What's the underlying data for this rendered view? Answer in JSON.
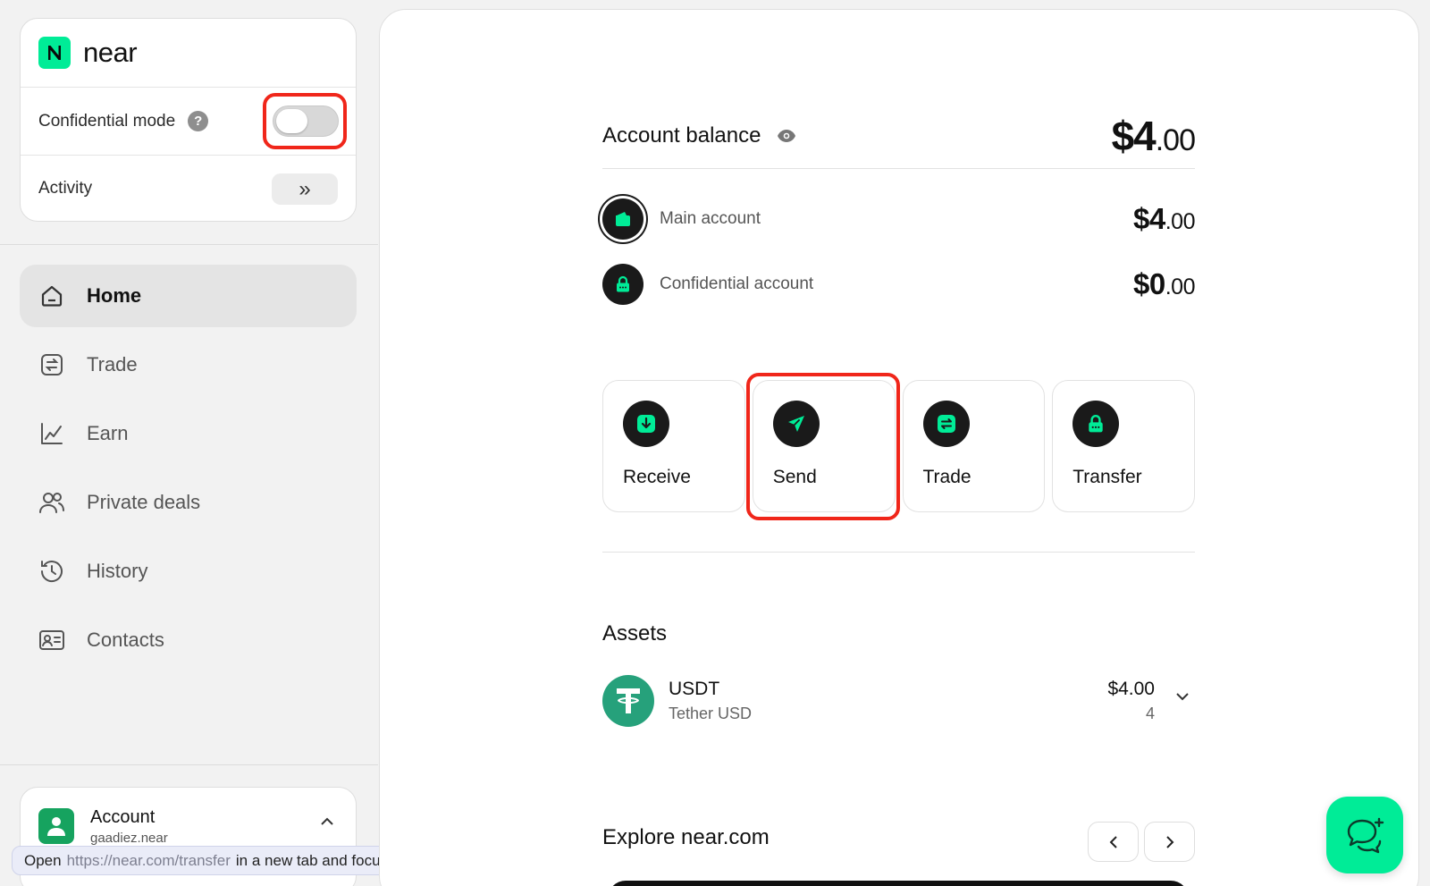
{
  "brand": {
    "name": "near"
  },
  "top_card": {
    "confidential_label": "Confidential mode",
    "help_icon": "?",
    "confidential_enabled": false,
    "activity_label": "Activity",
    "activity_icon": "»"
  },
  "nav": {
    "items": [
      {
        "label": "Home",
        "icon": "home-icon",
        "active": true
      },
      {
        "label": "Trade",
        "icon": "trade-icon",
        "active": false
      },
      {
        "label": "Earn",
        "icon": "chart-icon",
        "active": false
      },
      {
        "label": "Private deals",
        "icon": "users-icon",
        "active": false
      },
      {
        "label": "History",
        "icon": "history-icon",
        "active": false
      },
      {
        "label": "Contacts",
        "icon": "contact-card-icon",
        "active": false
      }
    ]
  },
  "account": {
    "title": "Account",
    "subtitle": "gaadiez.near"
  },
  "tooltip": {
    "prefix": "Open",
    "url": "https://near.com/transfer",
    "suffix": "in a new tab and focus it"
  },
  "balance": {
    "label": "Account balance",
    "whole": "$4",
    "cents": ".00"
  },
  "accounts": [
    {
      "label": "Main account",
      "whole": "$4",
      "cents": ".00",
      "icon": "wallet-icon",
      "selected": true
    },
    {
      "label": "Confidential account",
      "whole": "$0",
      "cents": ".00",
      "icon": "lock-icon",
      "selected": false
    }
  ],
  "actions": [
    {
      "label": "Receive",
      "icon": "download-icon"
    },
    {
      "label": "Send",
      "icon": "send-icon"
    },
    {
      "label": "Trade",
      "icon": "trade-icon"
    },
    {
      "label": "Transfer",
      "icon": "lock-icon"
    }
  ],
  "assets": {
    "title": "Assets",
    "items": [
      {
        "symbol": "USDT",
        "name": "Tether USD",
        "value": "$4.00",
        "quantity": "4"
      }
    ]
  },
  "explore": {
    "title": "Explore near.com",
    "prev_icon": "‹",
    "next_icon": "›"
  },
  "colors": {
    "accent": "#00ec97",
    "highlight": "#f0261a",
    "dark": "#1a1a1a",
    "usdt": "#26a17b"
  }
}
